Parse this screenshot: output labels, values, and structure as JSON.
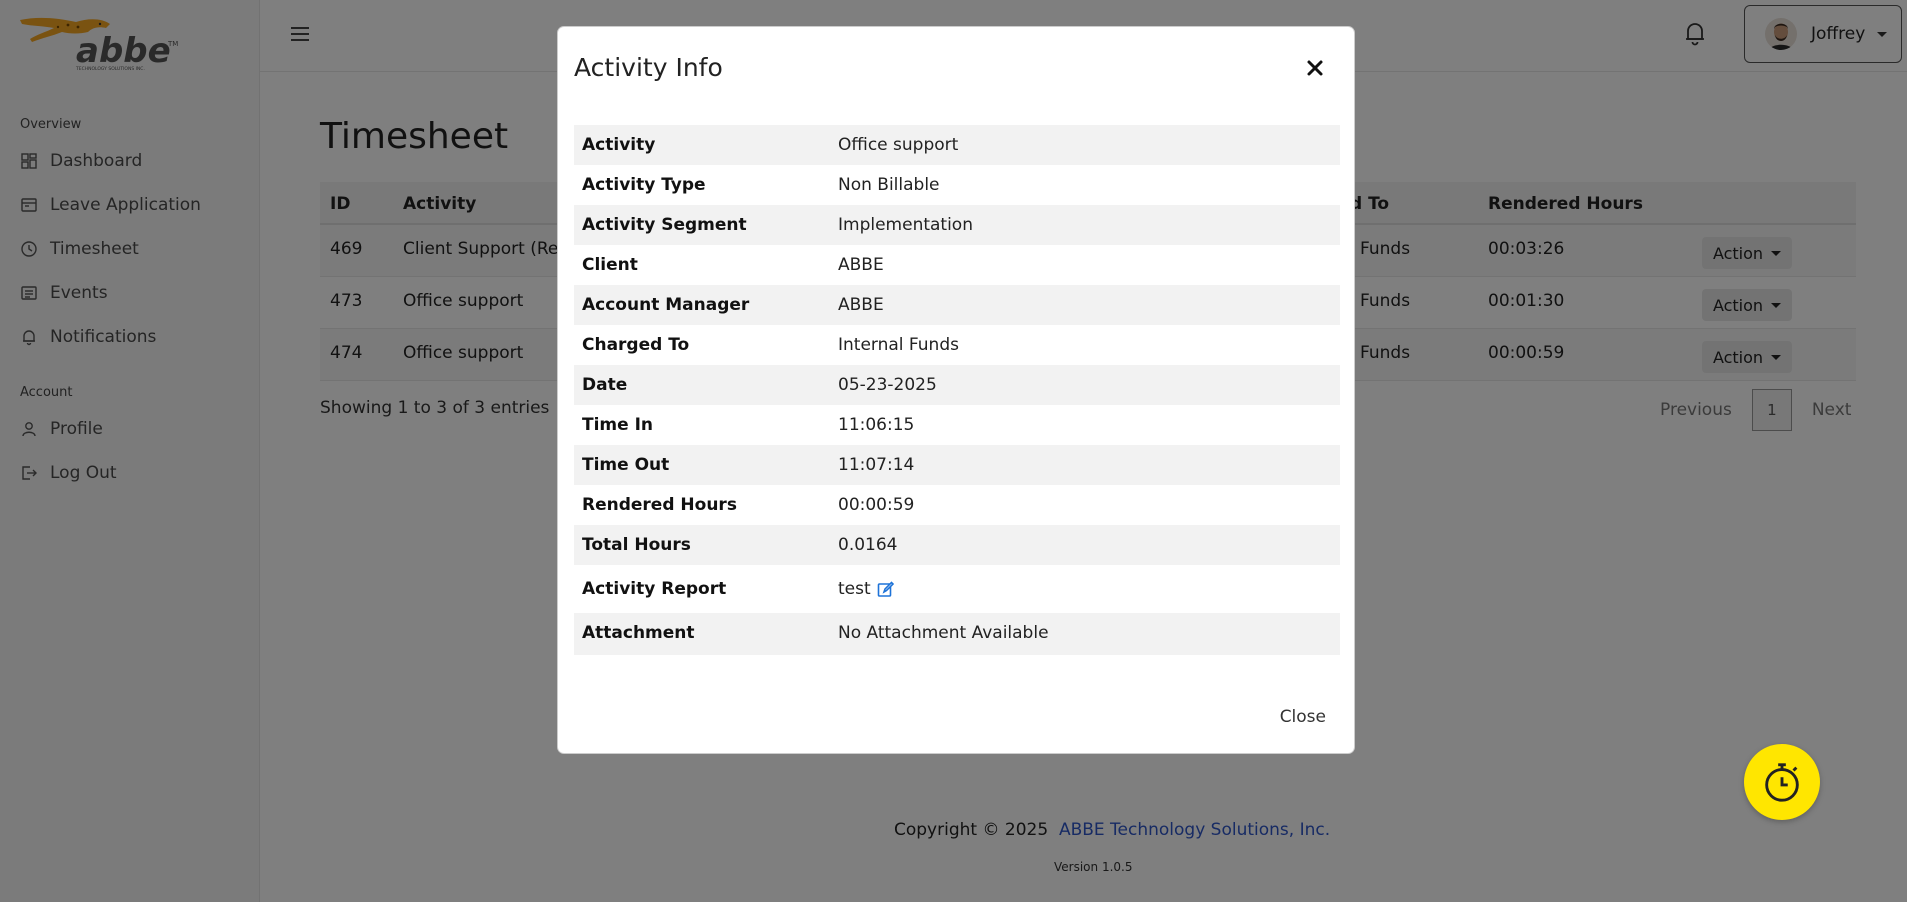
{
  "brand": {
    "logo_text": "abbe",
    "logo_subtext": "TECHNOLOGY SOLUTIONS INC."
  },
  "sidebar": {
    "sections": [
      {
        "title": "Overview",
        "items": [
          {
            "label": "Dashboard",
            "icon": "dashboard-icon"
          },
          {
            "label": "Leave Application",
            "icon": "calendar-icon"
          },
          {
            "label": "Timesheet",
            "icon": "clock-icon"
          },
          {
            "label": "Events",
            "icon": "events-icon"
          },
          {
            "label": "Notifications",
            "icon": "bell-icon"
          }
        ]
      },
      {
        "title": "Account",
        "items": [
          {
            "label": "Profile",
            "icon": "user-icon"
          },
          {
            "label": "Log Out",
            "icon": "logout-icon"
          }
        ]
      }
    ]
  },
  "topbar": {
    "user_name": "Joffrey"
  },
  "page": {
    "title": "Timesheet",
    "table": {
      "headers": [
        "ID",
        "Activity",
        "d To",
        "Rendered Hours"
      ],
      "rows": [
        {
          "id": "469",
          "activity": "Client Support (Ren",
          "charged_to": "Funds",
          "rendered": "00:03:26",
          "action": "Action"
        },
        {
          "id": "473",
          "activity": "Office support",
          "charged_to": "Funds",
          "rendered": "00:01:30",
          "action": "Action"
        },
        {
          "id": "474",
          "activity": "Office support",
          "charged_to": "Funds",
          "rendered": "00:00:59",
          "action": "Action"
        }
      ]
    },
    "showing": "Showing 1 to 3 of 3 entries",
    "pagination": {
      "previous": "Previous",
      "current": "1",
      "next": "Next"
    }
  },
  "footer": {
    "copyright": "Copyright © 2025",
    "company": "ABBE Technology Solutions, Inc.",
    "version": "Version 1.0.5"
  },
  "modal": {
    "title": "Activity Info",
    "rows": [
      {
        "label": "Activity",
        "value": "Office support"
      },
      {
        "label": "Activity Type",
        "value": "Non Billable"
      },
      {
        "label": "Activity Segment",
        "value": "Implementation"
      },
      {
        "label": "Client",
        "value": "ABBE"
      },
      {
        "label": "Account Manager",
        "value": "ABBE"
      },
      {
        "label": "Charged To",
        "value": "Internal Funds"
      },
      {
        "label": "Date",
        "value": "05-23-2025"
      },
      {
        "label": "Time In",
        "value": "11:06:15"
      },
      {
        "label": "Time Out",
        "value": "11:07:14"
      },
      {
        "label": "Rendered Hours",
        "value": "00:00:59"
      },
      {
        "label": "Total Hours",
        "value": "0.0164"
      },
      {
        "label": "Activity Report",
        "value": "test"
      },
      {
        "label": "Attachment",
        "value": "No Attachment Available"
      }
    ],
    "close_label": "Close"
  },
  "colors": {
    "accent_yellow": "#ffe600",
    "link_blue": "#2f56c8",
    "edit_blue": "#1e73d8",
    "logo_orange": "#f5a623"
  }
}
